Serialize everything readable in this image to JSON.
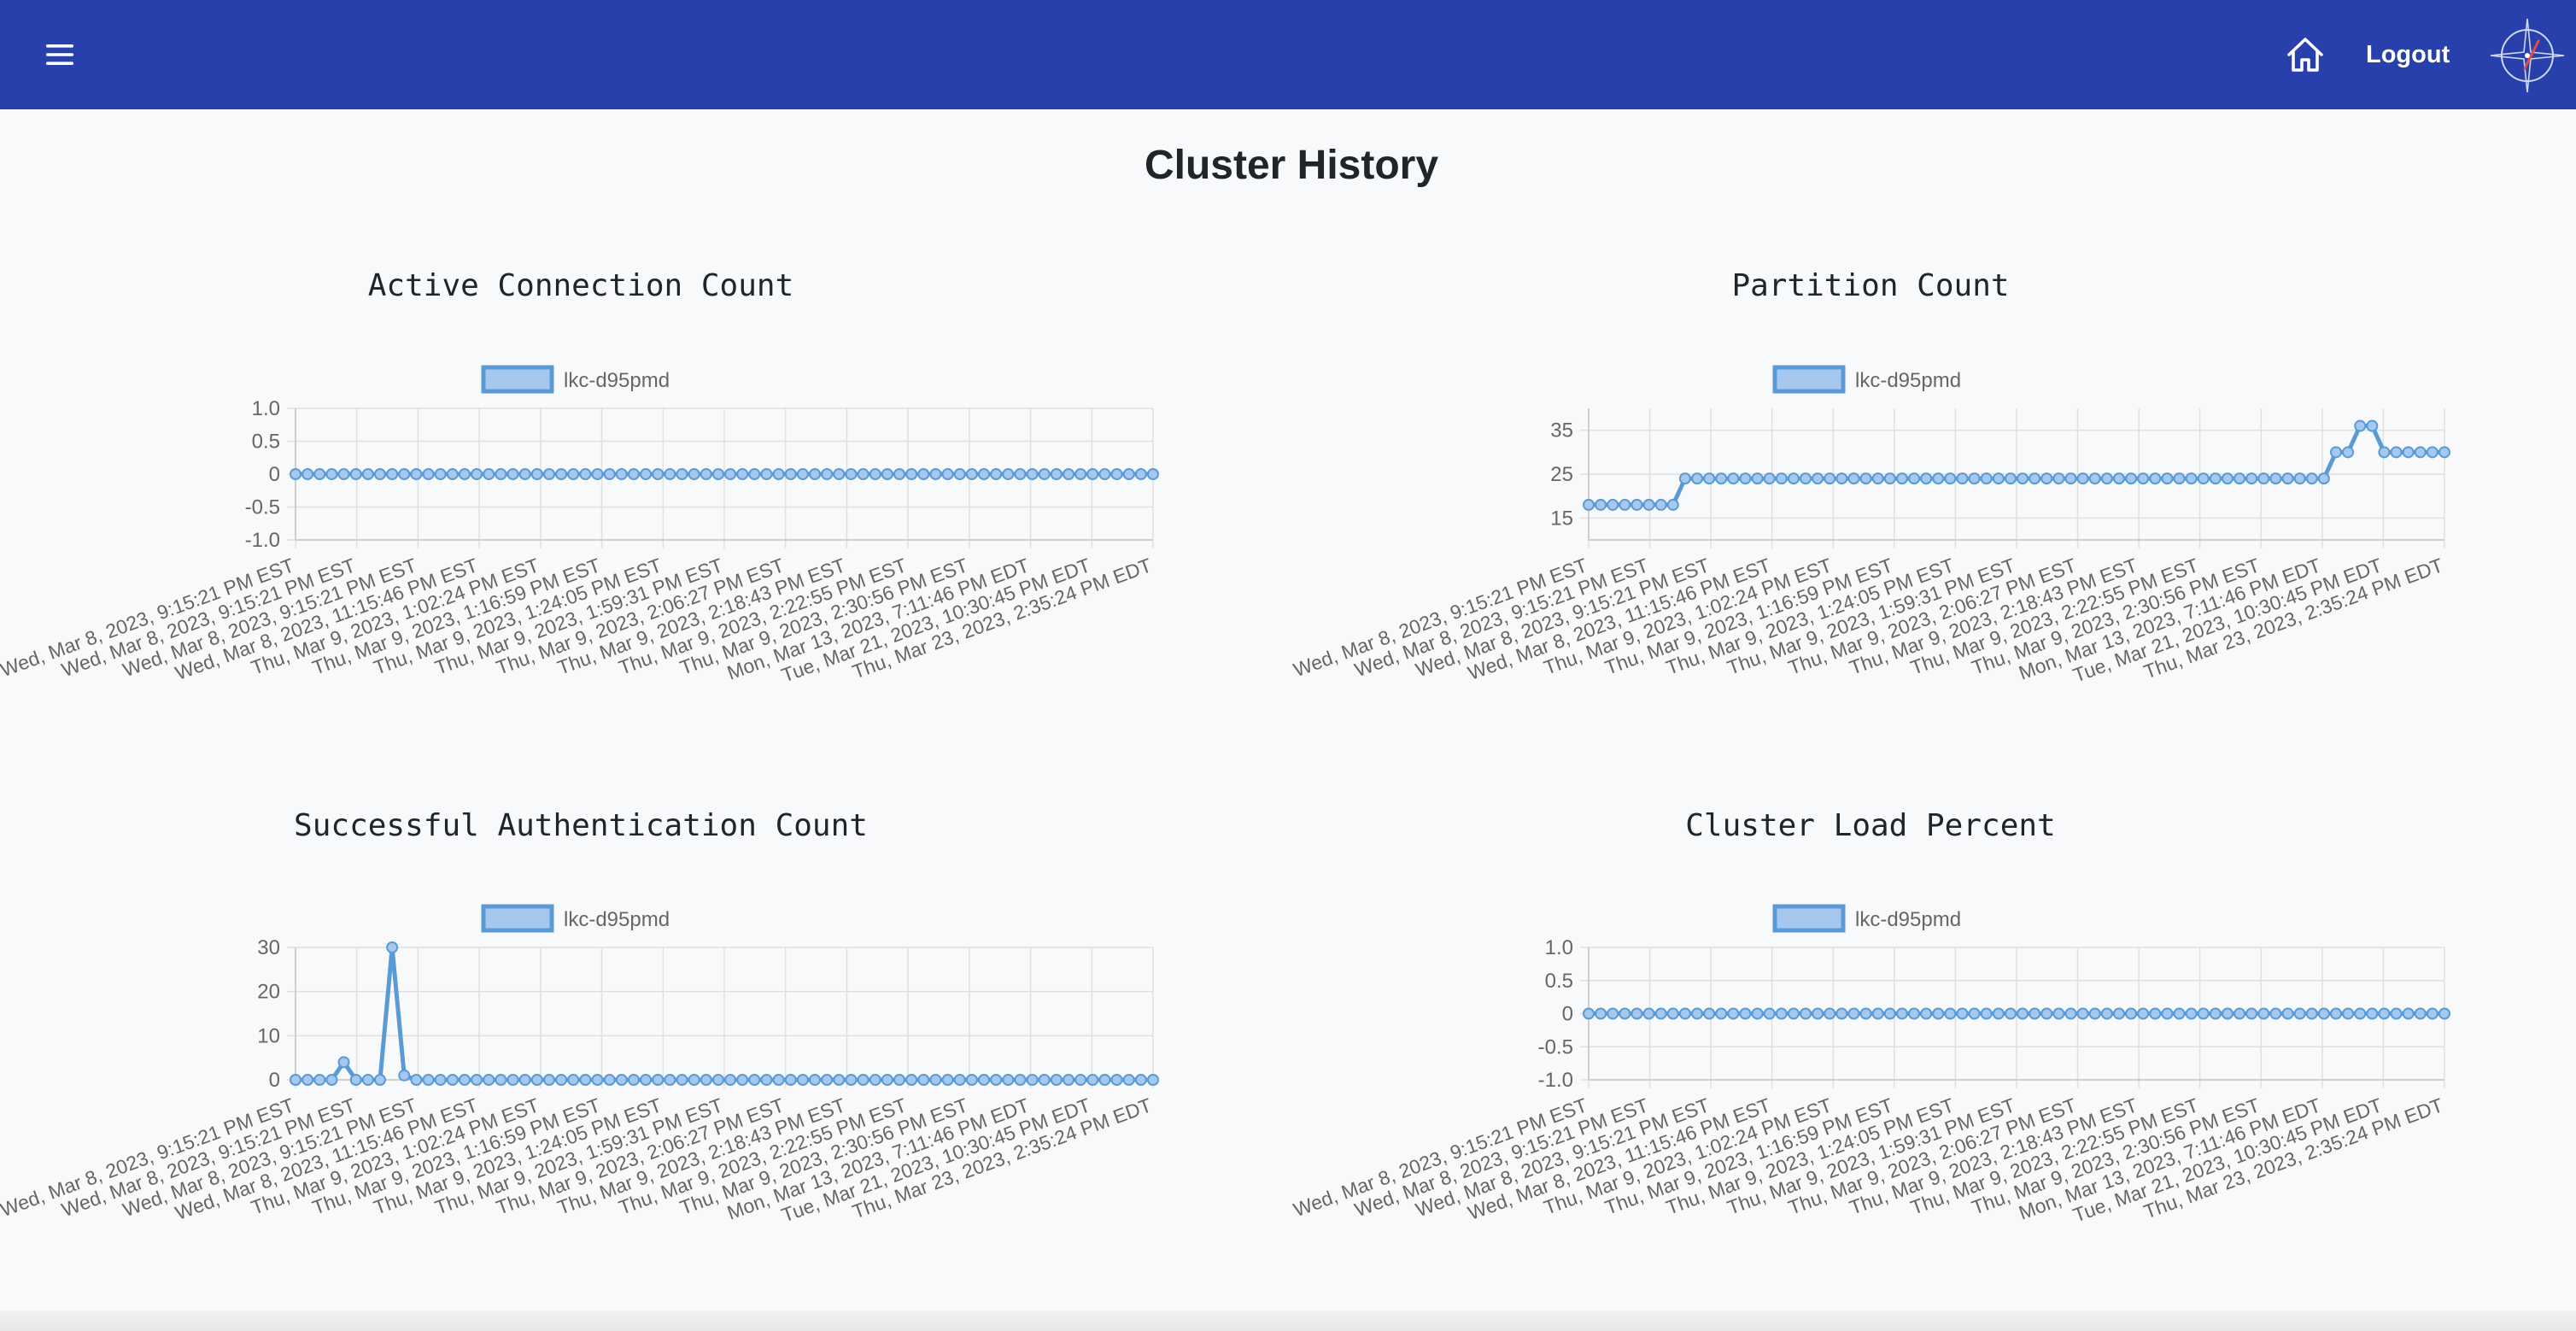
{
  "navbar": {
    "logout_label": "Logout",
    "menu_icon": "hamburger-menu-icon",
    "home_icon": "home-icon",
    "logo_icon": "compass-logo-icon",
    "background": "#2740ab"
  },
  "page": {
    "title": "Cluster History"
  },
  "series_color": "#5b9bd5",
  "timestamps": [
    "Wed, Mar 8, 2023, 9:15:21 PM EST",
    "Wed, Mar 8, 2023, 9:15:21 PM EST",
    "Wed, Mar 8, 2023, 9:15:21 PM EST",
    "Wed, Mar 8, 2023, 11:15:46 PM EST",
    "Thu, Mar 9, 2023, 1:02:24 PM EST",
    "Thu, Mar 9, 2023, 1:16:59 PM EST",
    "Thu, Mar 9, 2023, 1:24:05 PM EST",
    "Thu, Mar 9, 2023, 1:59:31 PM EST",
    "Thu, Mar 9, 2023, 2:06:27 PM EST",
    "Thu, Mar 9, 2023, 2:18:43 PM EST",
    "Thu, Mar 9, 2023, 2:22:55 PM EST",
    "Thu, Mar 9, 2023, 2:30:56 PM EST",
    "Mon, Mar 13, 2023, 7:11:46 PM EDT",
    "Tue, Mar 21, 2023, 10:30:45 PM EDT",
    "Thu, Mar 23, 2023, 2:35:24 PM EDT"
  ],
  "chart_data": [
    {
      "type": "line",
      "title": "Active Connection Count",
      "legend": "lkc-d95pmd",
      "ylim": [
        -1,
        1
      ],
      "yticks": [
        "1.0",
        "0.5",
        "0",
        "-0.5",
        "-1.0"
      ],
      "point_count": 72,
      "values": [
        0
      ]
    },
    {
      "type": "line",
      "title": "Partition Count",
      "legend": "lkc-d95pmd",
      "ylim": [
        10,
        40
      ],
      "yticks": [
        "35",
        "25",
        "15"
      ],
      "point_count": 72,
      "values": [
        18,
        18,
        18,
        18,
        18,
        18,
        18,
        18,
        24,
        24,
        24,
        24,
        24,
        24,
        24,
        24,
        24,
        24,
        24,
        24,
        24,
        24,
        24,
        24,
        24,
        24,
        24,
        24,
        24,
        24,
        24,
        24,
        24,
        24,
        24,
        24,
        24,
        24,
        24,
        24,
        24,
        24,
        24,
        24,
        24,
        24,
        24,
        24,
        24,
        24,
        24,
        24,
        24,
        24,
        24,
        24,
        24,
        24,
        24,
        24,
        24,
        24,
        30,
        30,
        36,
        36,
        30,
        30,
        30,
        30,
        30,
        30
      ]
    },
    {
      "type": "line",
      "title": "Successful Authentication Count",
      "legend": "lkc-d95pmd",
      "ylim": [
        0,
        30
      ],
      "yticks": [
        "30",
        "20",
        "10",
        "0"
      ],
      "point_count": 72,
      "values": [
        0,
        0,
        0,
        0,
        4,
        0,
        0,
        0,
        30,
        1
      ]
    },
    {
      "type": "line",
      "title": "Cluster Load Percent",
      "legend": "lkc-d95pmd",
      "ylim": [
        -1,
        1
      ],
      "yticks": [
        "1.0",
        "0.5",
        "0",
        "-0.5",
        "-1.0"
      ],
      "point_count": 72,
      "values": [
        0
      ]
    }
  ]
}
